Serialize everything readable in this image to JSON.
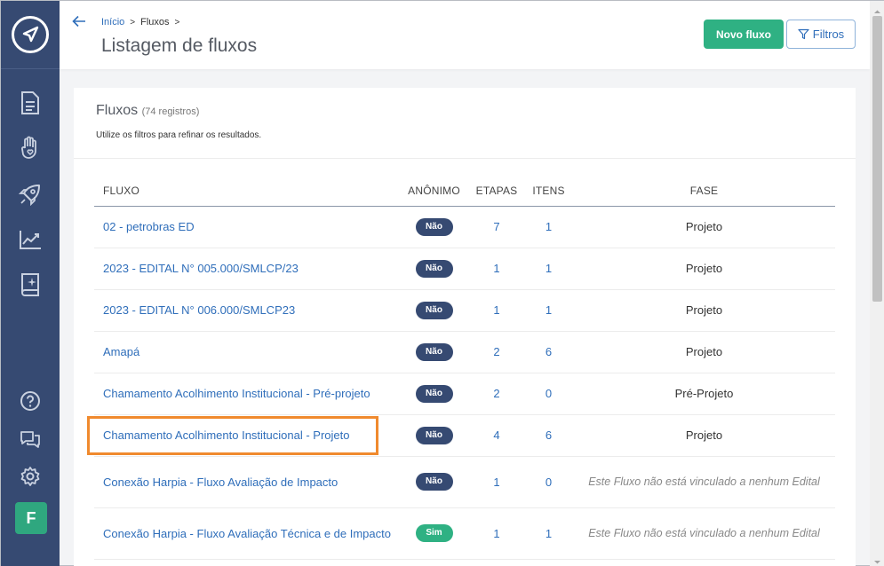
{
  "breadcrumb": {
    "home": "Início",
    "current": "Fluxos"
  },
  "page_title": "Listagem de fluxos",
  "buttons": {
    "new_flow": "Novo fluxo",
    "filters": "Filtros"
  },
  "card": {
    "title": "Fluxos",
    "count": "(74 registros)",
    "subtitle": "Utilize os filtros para refinar os resultados."
  },
  "table": {
    "headers": {
      "flow": "FLUXO",
      "anonymous": "ANÔNIMO",
      "steps": "ETAPAS",
      "items": "ITENS",
      "phase": "FASE"
    },
    "rows": [
      {
        "name": "02 - petrobras ED",
        "anonymous": "Não",
        "steps": "7",
        "items": "1",
        "phase": "Projeto"
      },
      {
        "name": "2023 - EDITAL N° 005.000/SMLCP/23",
        "anonymous": "Não",
        "steps": "1",
        "items": "1",
        "phase": "Projeto"
      },
      {
        "name": "2023 - EDITAL N° 006.000/SMLCP23",
        "anonymous": "Não",
        "steps": "1",
        "items": "1",
        "phase": "Projeto"
      },
      {
        "name": "Amapá",
        "anonymous": "Não",
        "steps": "2",
        "items": "6",
        "phase": "Projeto"
      },
      {
        "name": "Chamamento Acolhimento Institucional - Pré-projeto",
        "anonymous": "Não",
        "steps": "2",
        "items": "0",
        "phase": "Pré-Projeto"
      },
      {
        "name": "Chamamento Acolhimento Institucional - Projeto",
        "anonymous": "Não",
        "steps": "4",
        "items": "6",
        "phase": "Projeto"
      },
      {
        "name": "Conexão Harpia - Fluxo Avaliação de Impacto",
        "anonymous": "Não",
        "steps": "1",
        "items": "0",
        "phase": "Este Fluxo não está vinculado a nenhum Edital"
      },
      {
        "name": "Conexão Harpia - Fluxo Avaliação Técnica e de Impacto",
        "anonymous": "Sim",
        "steps": "1",
        "items": "1",
        "phase": "Este Fluxo não está vinculado a nenhum Edital"
      }
    ]
  },
  "user": {
    "avatar_initial": "F"
  },
  "colors": {
    "sidebar": "#364a72",
    "primary": "#2fb183",
    "link": "#2f6eba",
    "highlight": "#f08a2e"
  }
}
